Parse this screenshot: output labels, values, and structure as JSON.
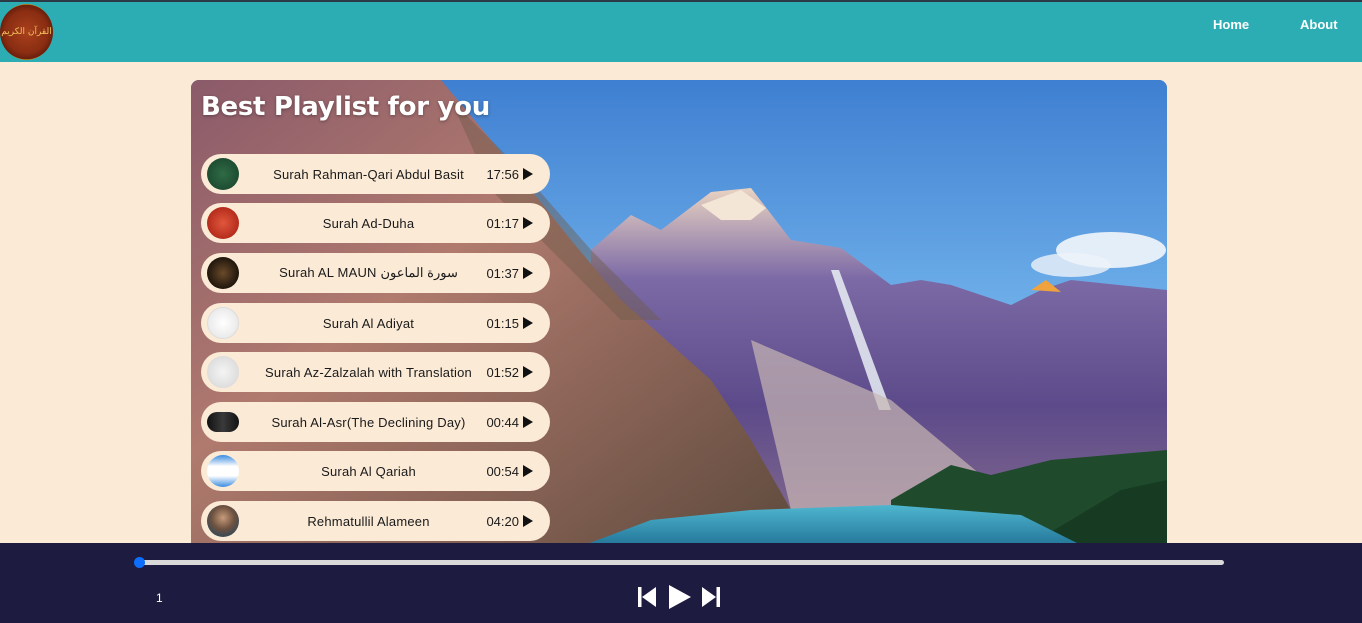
{
  "nav": {
    "logo_alt": "القرآن الكريم",
    "links": [
      "Home",
      "About"
    ]
  },
  "playlist": {
    "title": "Best Playlist for you",
    "tracks": [
      {
        "name": "Surah Rahman-Qari Abdul Basit",
        "duration": "17:56"
      },
      {
        "name": "Surah Ad-Duha",
        "duration": "01:17"
      },
      {
        "name": "Surah AL MAUN سورة الماعون",
        "duration": "01:37"
      },
      {
        "name": "Surah Al Adiyat",
        "duration": "01:15"
      },
      {
        "name": "Surah Az-Zalzalah with Translation",
        "duration": "01:52"
      },
      {
        "name": "Surah Al-Asr(The Declining Day)",
        "duration": "00:44"
      },
      {
        "name": "Surah Al Qariah",
        "duration": "00:54"
      },
      {
        "name": "Rehmatullil Alameen",
        "duration": "04:20"
      }
    ]
  },
  "player": {
    "current_time": "1",
    "progress": 0.0
  },
  "colors": {
    "navbar": "#2cadb3",
    "page_bg": "#fbebd6",
    "player_bg": "#1d1b40",
    "accent": "#0d6efd"
  },
  "icons": [
    "quran-logo-icon",
    "play-icon",
    "previous-icon",
    "next-icon"
  ]
}
